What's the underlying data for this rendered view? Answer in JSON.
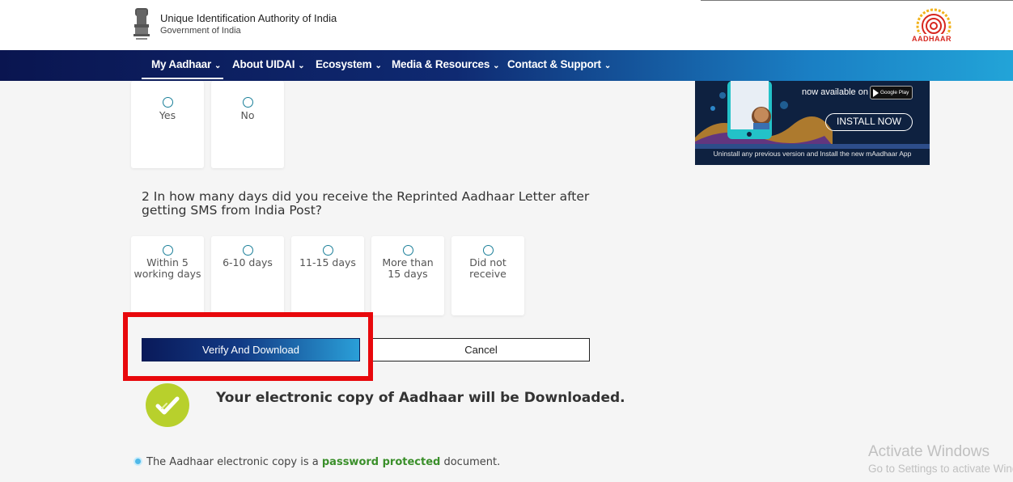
{
  "header": {
    "org_name": "Unique Identification Authority of India",
    "org_sub": "Government of India",
    "logo_text": "AADHAAR"
  },
  "nav": {
    "items": [
      {
        "label": "My Aadhaar"
      },
      {
        "label": "About UIDAI"
      },
      {
        "label": "Ecosystem"
      },
      {
        "label": "Media & Resources"
      },
      {
        "label": "Contact & Support"
      }
    ],
    "chevron": "⌄"
  },
  "question1": {
    "options": [
      {
        "label": "Yes"
      },
      {
        "label": "No"
      }
    ]
  },
  "question2": {
    "text": "2 In how many days did you receive the Reprinted Aadhaar Letter after getting SMS from India Post?",
    "options": [
      {
        "label_line1": "Within 5",
        "label_line2": "working days"
      },
      {
        "label_line1": "6-10 days",
        "label_line2": ""
      },
      {
        "label_line1": "11-15 days",
        "label_line2": ""
      },
      {
        "label_line1": "More than",
        "label_line2": "15 days"
      },
      {
        "label_line1": "Did not",
        "label_line2": "receive"
      }
    ]
  },
  "actions": {
    "verify_label": "Verify And Download",
    "cancel_label": "Cancel"
  },
  "download_message": "Your electronic copy of Aadhaar will be Downloaded.",
  "info": {
    "before": "The Aadhaar electronic copy is a ",
    "highlight": "password protected",
    "after": " document."
  },
  "banner": {
    "available": "now available on",
    "store": "Google Play",
    "install": "INSTALL NOW",
    "note": "Uninstall any previous version and Install the new mAadhaar App"
  },
  "watermark": {
    "title": "Activate Windows",
    "sub": "Go to Settings to activate Windows."
  },
  "colors": {
    "nav_start": "#0a1550",
    "nav_end": "#22a4d8",
    "highlight_red": "#e8080c",
    "check_green": "#b8d02c",
    "link_green": "#3a8f2a"
  }
}
